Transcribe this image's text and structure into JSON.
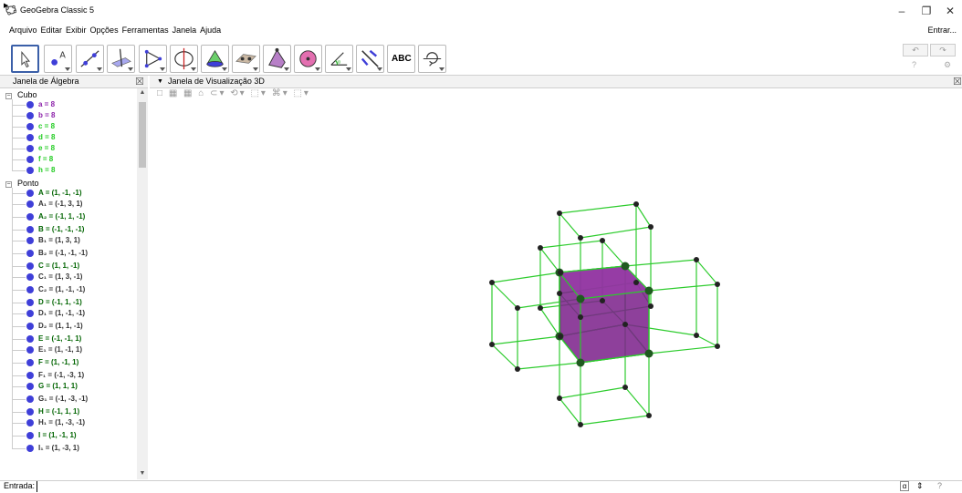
{
  "window": {
    "title": "GeoGebra Classic 5",
    "minimize": "–",
    "maximize": "❐",
    "close": "✕"
  },
  "menu": {
    "items": [
      "Arquivo",
      "Editar",
      "Exibir",
      "Opções",
      "Ferramentas",
      "Janela",
      "Ajuda"
    ],
    "signin": "Entrar..."
  },
  "toolbar": {
    "tools": [
      "move",
      "point",
      "line",
      "perpendicular",
      "polygon",
      "circle-axis",
      "intersect",
      "plane",
      "pyramid",
      "sphere",
      "angle",
      "reflect",
      "text",
      "rotate-view"
    ],
    "text_tool_label": "ABC",
    "undo": "↶",
    "redo": "↷",
    "help": "?",
    "settings": "⚙"
  },
  "algebra": {
    "title": "Janela de Álgebra",
    "close": "☒",
    "categories": [
      {
        "name": "Cubo",
        "items": [
          {
            "text": "a = 8",
            "color": "#8a1fa8"
          },
          {
            "text": "b = 8",
            "color": "#8a1fa8"
          },
          {
            "text": "c = 8",
            "color": "#22cc22"
          },
          {
            "text": "d = 8",
            "color": "#22cc22"
          },
          {
            "text": "e = 8",
            "color": "#22cc22"
          },
          {
            "text": "f = 8",
            "color": "#22cc22"
          },
          {
            "text": "h = 8",
            "color": "#22cc22"
          }
        ]
      },
      {
        "name": "Ponto",
        "items": [
          {
            "text": "A = (1, -1, -1)",
            "color": "#006400"
          },
          {
            "text": "A₁ = (-1, 3, 1)",
            "color": "#333333"
          },
          {
            "text": "A₂ = (-1, 1, -1)",
            "color": "#006400"
          },
          {
            "text": "B = (-1, -1, -1)",
            "color": "#006400"
          },
          {
            "text": "B₁ = (1, 3, 1)",
            "color": "#333333"
          },
          {
            "text": "B₂ = (-1, -1, -1)",
            "color": "#333333"
          },
          {
            "text": "C = (1, 1, -1)",
            "color": "#006400"
          },
          {
            "text": "C₁ = (1, 3, -1)",
            "color": "#333333"
          },
          {
            "text": "C₂ = (1, -1, -1)",
            "color": "#333333"
          },
          {
            "text": "D = (-1, 1, -1)",
            "color": "#006400"
          },
          {
            "text": "D₁ = (1, -1, -1)",
            "color": "#333333"
          },
          {
            "text": "D₂ = (1, 1, -1)",
            "color": "#333333"
          },
          {
            "text": "E = (-1, -1, 1)",
            "color": "#006400"
          },
          {
            "text": "E₁ = (1, -1, 1)",
            "color": "#333333"
          },
          {
            "text": "F = (1, -1, 1)",
            "color": "#006400"
          },
          {
            "text": "F₁ = (-1, -3, 1)",
            "color": "#333333"
          },
          {
            "text": "G = (1, 1, 1)",
            "color": "#006400"
          },
          {
            "text": "G₁ = (-1, -3, -1)",
            "color": "#333333"
          },
          {
            "text": "H = (-1, 1, 1)",
            "color": "#006400"
          },
          {
            "text": "H₁ = (1, -3, -1)",
            "color": "#333333"
          },
          {
            "text": "I = (1, -1, 1)",
            "color": "#006400"
          },
          {
            "text": "I₁ = (1, -3, 1)",
            "color": "#333333"
          }
        ]
      }
    ]
  },
  "graphics": {
    "title": "Janela de Visualização 3D",
    "close": "☒",
    "style_bar": "□ ▦ ▦ ⌂ ⊂▾ ⟲▾ ⬚▾ ⌘▾ ⬚▾",
    "cube_color": "#7a1f8a",
    "edge_color": "#2ecc2e"
  },
  "input": {
    "label": "Entrada:",
    "value": "",
    "alpha": "α",
    "updown": "⇕",
    "help": "?"
  }
}
